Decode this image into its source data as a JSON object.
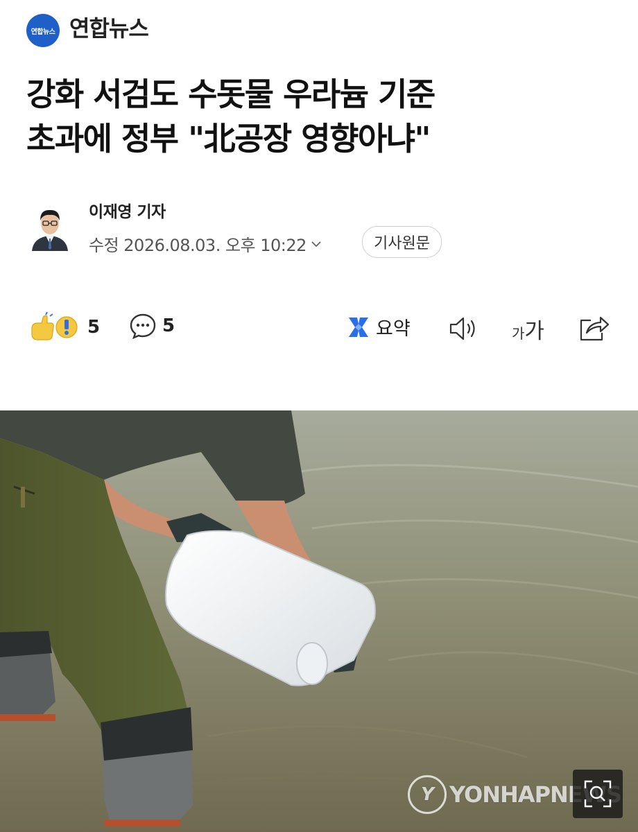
{
  "press": {
    "logo_text": "연합뉴스",
    "name": "연합뉴스"
  },
  "article": {
    "title_line1": "강화 서검도 수돗물 우라늄 기준",
    "title_line2": "초과에 정부 \"北공장 영향아냐\"",
    "author": "이재영 기자",
    "date": "수정 2026.08.03. 오후 10:22",
    "original_button": "기사원문"
  },
  "actions": {
    "reaction_count": "5",
    "comment_count": "5",
    "summary_label": "요약",
    "font_small": "가",
    "font_big": "가"
  },
  "photo": {
    "watermark": "YONHAPNEWS",
    "watermark_seal": "Y"
  },
  "icons": {
    "press_logo": "press-logo-icon",
    "reaction": "reaction-emoji-icon",
    "comment": "comment-bubble-icon",
    "summary": "ai-summary-icon",
    "speaker": "speaker-icon",
    "font_size": "font-size-icon",
    "share": "share-icon",
    "zoom": "zoom-icon",
    "chevron": "chevron-down-icon"
  },
  "colors": {
    "brand": "#1f5fc8",
    "summary_accent": "#2b6fe8"
  }
}
